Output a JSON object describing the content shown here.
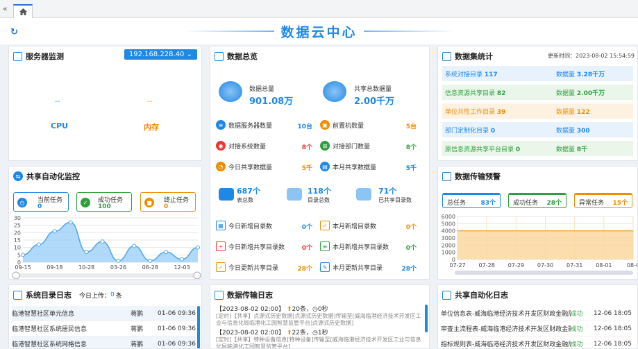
{
  "title": "数据云中心",
  "server": {
    "title": "服务器监测",
    "ip": "192.168.228.40",
    "cpu_val": "--",
    "cpu_label": "CPU",
    "mem_val": "--",
    "mem_label": "内存"
  },
  "overview": {
    "title": "数据总览",
    "total_label": "数据总量",
    "total_value": "901.08万",
    "share_label": "共享总数据量",
    "share_value": "2.00千万",
    "stats": [
      {
        "label": "数据服务器数量",
        "value": "10台"
      },
      {
        "label": "前置机数量",
        "value": "5台"
      },
      {
        "label": "对接系统数量",
        "value": "8个"
      },
      {
        "label": "对接部门数量",
        "value": "8个"
      },
      {
        "label": "今日共享数据量",
        "value": "5千"
      },
      {
        "label": "本月共享数据量",
        "value": "5千"
      }
    ],
    "tables": {
      "value": "687个",
      "label": "表总数"
    },
    "catalogs": {
      "value": "118个",
      "label": "目录总数"
    },
    "shared_catalogs": {
      "value": "71个",
      "label": "已共享目录数"
    },
    "new": [
      {
        "label": "今日新增目录数",
        "value": "0个"
      },
      {
        "label": "本月新增目录数",
        "value": "0个"
      },
      {
        "label": "今日新增共享目录数",
        "value": "0个"
      },
      {
        "label": "本月新增共享目录数",
        "value": "0个"
      },
      {
        "label": "今日更新共享目录",
        "value": "28个"
      },
      {
        "label": "本月更新共享目录",
        "value": "28个"
      }
    ]
  },
  "dataset": {
    "title": "数据集统计",
    "update_time": "更新时间：2023-08-02 15:54:59",
    "rows": [
      {
        "left_label": "系统对接目录",
        "left_value": "117",
        "right_label": "数据量",
        "right_value": "3.28千万"
      },
      {
        "left_label": "信息资源共享目录",
        "left_value": "82",
        "right_label": "数据量",
        "right_value": "2.00千万"
      },
      {
        "left_label": "单位共性工作目录",
        "left_value": "39",
        "right_label": "数据量",
        "right_value": "122"
      },
      {
        "left_label": "部门定制化目录",
        "left_value": "0",
        "right_label": "数据量",
        "right_value": "300"
      },
      {
        "left_label": "原信息资源共享平台目录",
        "left_value": "0",
        "right_label": "数据量",
        "right_value": "8千"
      }
    ]
  },
  "automon": {
    "title": "共享自动化监控",
    "tasks": [
      {
        "label": "当前任务",
        "value": "0"
      },
      {
        "label": "成功任务",
        "value": "100"
      },
      {
        "label": "终止任务",
        "value": "0"
      }
    ]
  },
  "transfer_warn": {
    "title": "数据传输预警",
    "tasks": [
      {
        "label": "总任务",
        "value": "83个"
      },
      {
        "label": "成功任务",
        "value": "28个"
      },
      {
        "label": "异常任务",
        "value": "15个"
      }
    ]
  },
  "chart_data": [
    {
      "type": "area",
      "title": "",
      "x": [
        "09-15",
        "",
        "09-18",
        "",
        "10-28",
        "",
        "03-26",
        "",
        "06-28",
        "",
        "12-03",
        ""
      ],
      "series": [
        {
          "values": [
            5,
            12,
            21,
            27,
            7,
            14,
            1,
            11,
            1,
            7,
            2,
            10
          ]
        }
      ],
      "xticks": [
        "09-15",
        "09-18",
        "10-28",
        "03-26",
        "06-28",
        "12-03"
      ],
      "ylim": [
        0,
        30
      ],
      "yticks": [
        "0",
        "5",
        "10",
        "15",
        "20",
        "25",
        "30"
      ],
      "grid": true
    },
    {
      "type": "area",
      "title": "",
      "x": [
        "07-27",
        "07-28",
        "07-29",
        "07-30",
        "07-31",
        "08-01",
        "08-0"
      ],
      "series": [
        {
          "values": [
            4000,
            4000,
            4000,
            4000,
            4000,
            4000,
            4000
          ]
        }
      ],
      "ylim": [
        0,
        6000
      ],
      "yticks": [
        "0",
        "1000",
        "2000",
        "3000",
        "4000",
        "5000",
        "6000"
      ],
      "grid": true
    }
  ],
  "catalog_log": {
    "title": "系统目录日志",
    "today_label": "今日上传：",
    "today_value": "0",
    "today_unit": "条",
    "rows": [
      {
        "name": "临港智慧社区单元信息",
        "user": "蒋鹏",
        "time": "01-06 09:36"
      },
      {
        "name": "临港智慧社区系统居民信息",
        "user": "蒋鹏",
        "time": "01-06 09:36"
      },
      {
        "name": "临港智慧社区系统网格信息",
        "user": "蒋鹏",
        "time": "01-06 09:36"
      }
    ]
  },
  "transfer_log": {
    "title": "数据传输日志",
    "entries": [
      {
        "head": "【2023-08-02 02:00】",
        "up": "20条",
        "down": "0秒",
        "detail": "[定时]【共享】点源式历史数据[点源式历史数据]传输至[威海临港经济技术开发区工业与信息化局临港化工园智慧监管平台]点源式历史数据]"
      },
      {
        "head": "【2023-08-02 02:00】",
        "up": "22条",
        "down": "1秒",
        "detail": "[定时]【共享】特种设备信息[特种设备]传输至[威海临港经济技术开发区工业与信息化局临港化工园智慧监管平台]"
      }
    ]
  },
  "auto_log": {
    "title": "共享自动化日志",
    "rows": [
      {
        "name": "单位信息表-威海临港经济技术开发区财政金融局...",
        "status": "成功",
        "time": "12-06 18:05"
      },
      {
        "name": "审查主流程表-威海临港经济技术开发区财政金融局...",
        "status": "成功",
        "time": "12-06 18:05"
      },
      {
        "name": "指标规则表-威海临港经济技术开发区财政金融局...",
        "status": "成功",
        "time": "12-06 18:05"
      }
    ]
  },
  "colors": {
    "accent": "#1e88e5",
    "orange": "#f08c00",
    "green": "#2e9e3e",
    "red": "#e53935"
  }
}
